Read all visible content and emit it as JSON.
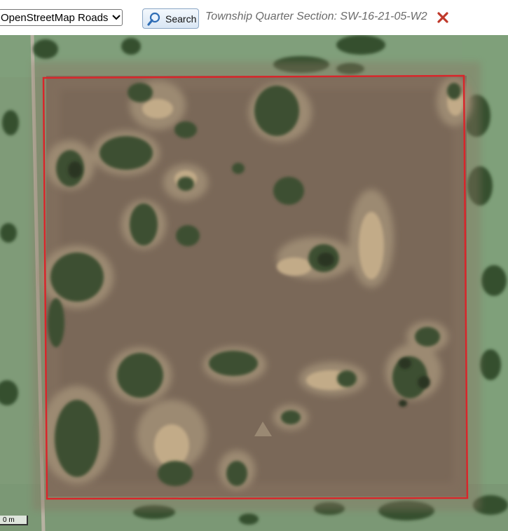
{
  "toolbar": {
    "layer_select": {
      "selected": "OpenStreetMap Roads"
    },
    "search_label": "Search",
    "location_text": "Township Quarter Section: SW-16-21-05-W2"
  },
  "map": {
    "parcel_outline_color": "#d8262b",
    "scale_label": "0 m"
  },
  "colors": {
    "field": "#7c6a5a",
    "pasture": "#7d9a78",
    "trees": "#3f5233",
    "button_icon": "#2f6db5",
    "close": "#c0392b"
  }
}
